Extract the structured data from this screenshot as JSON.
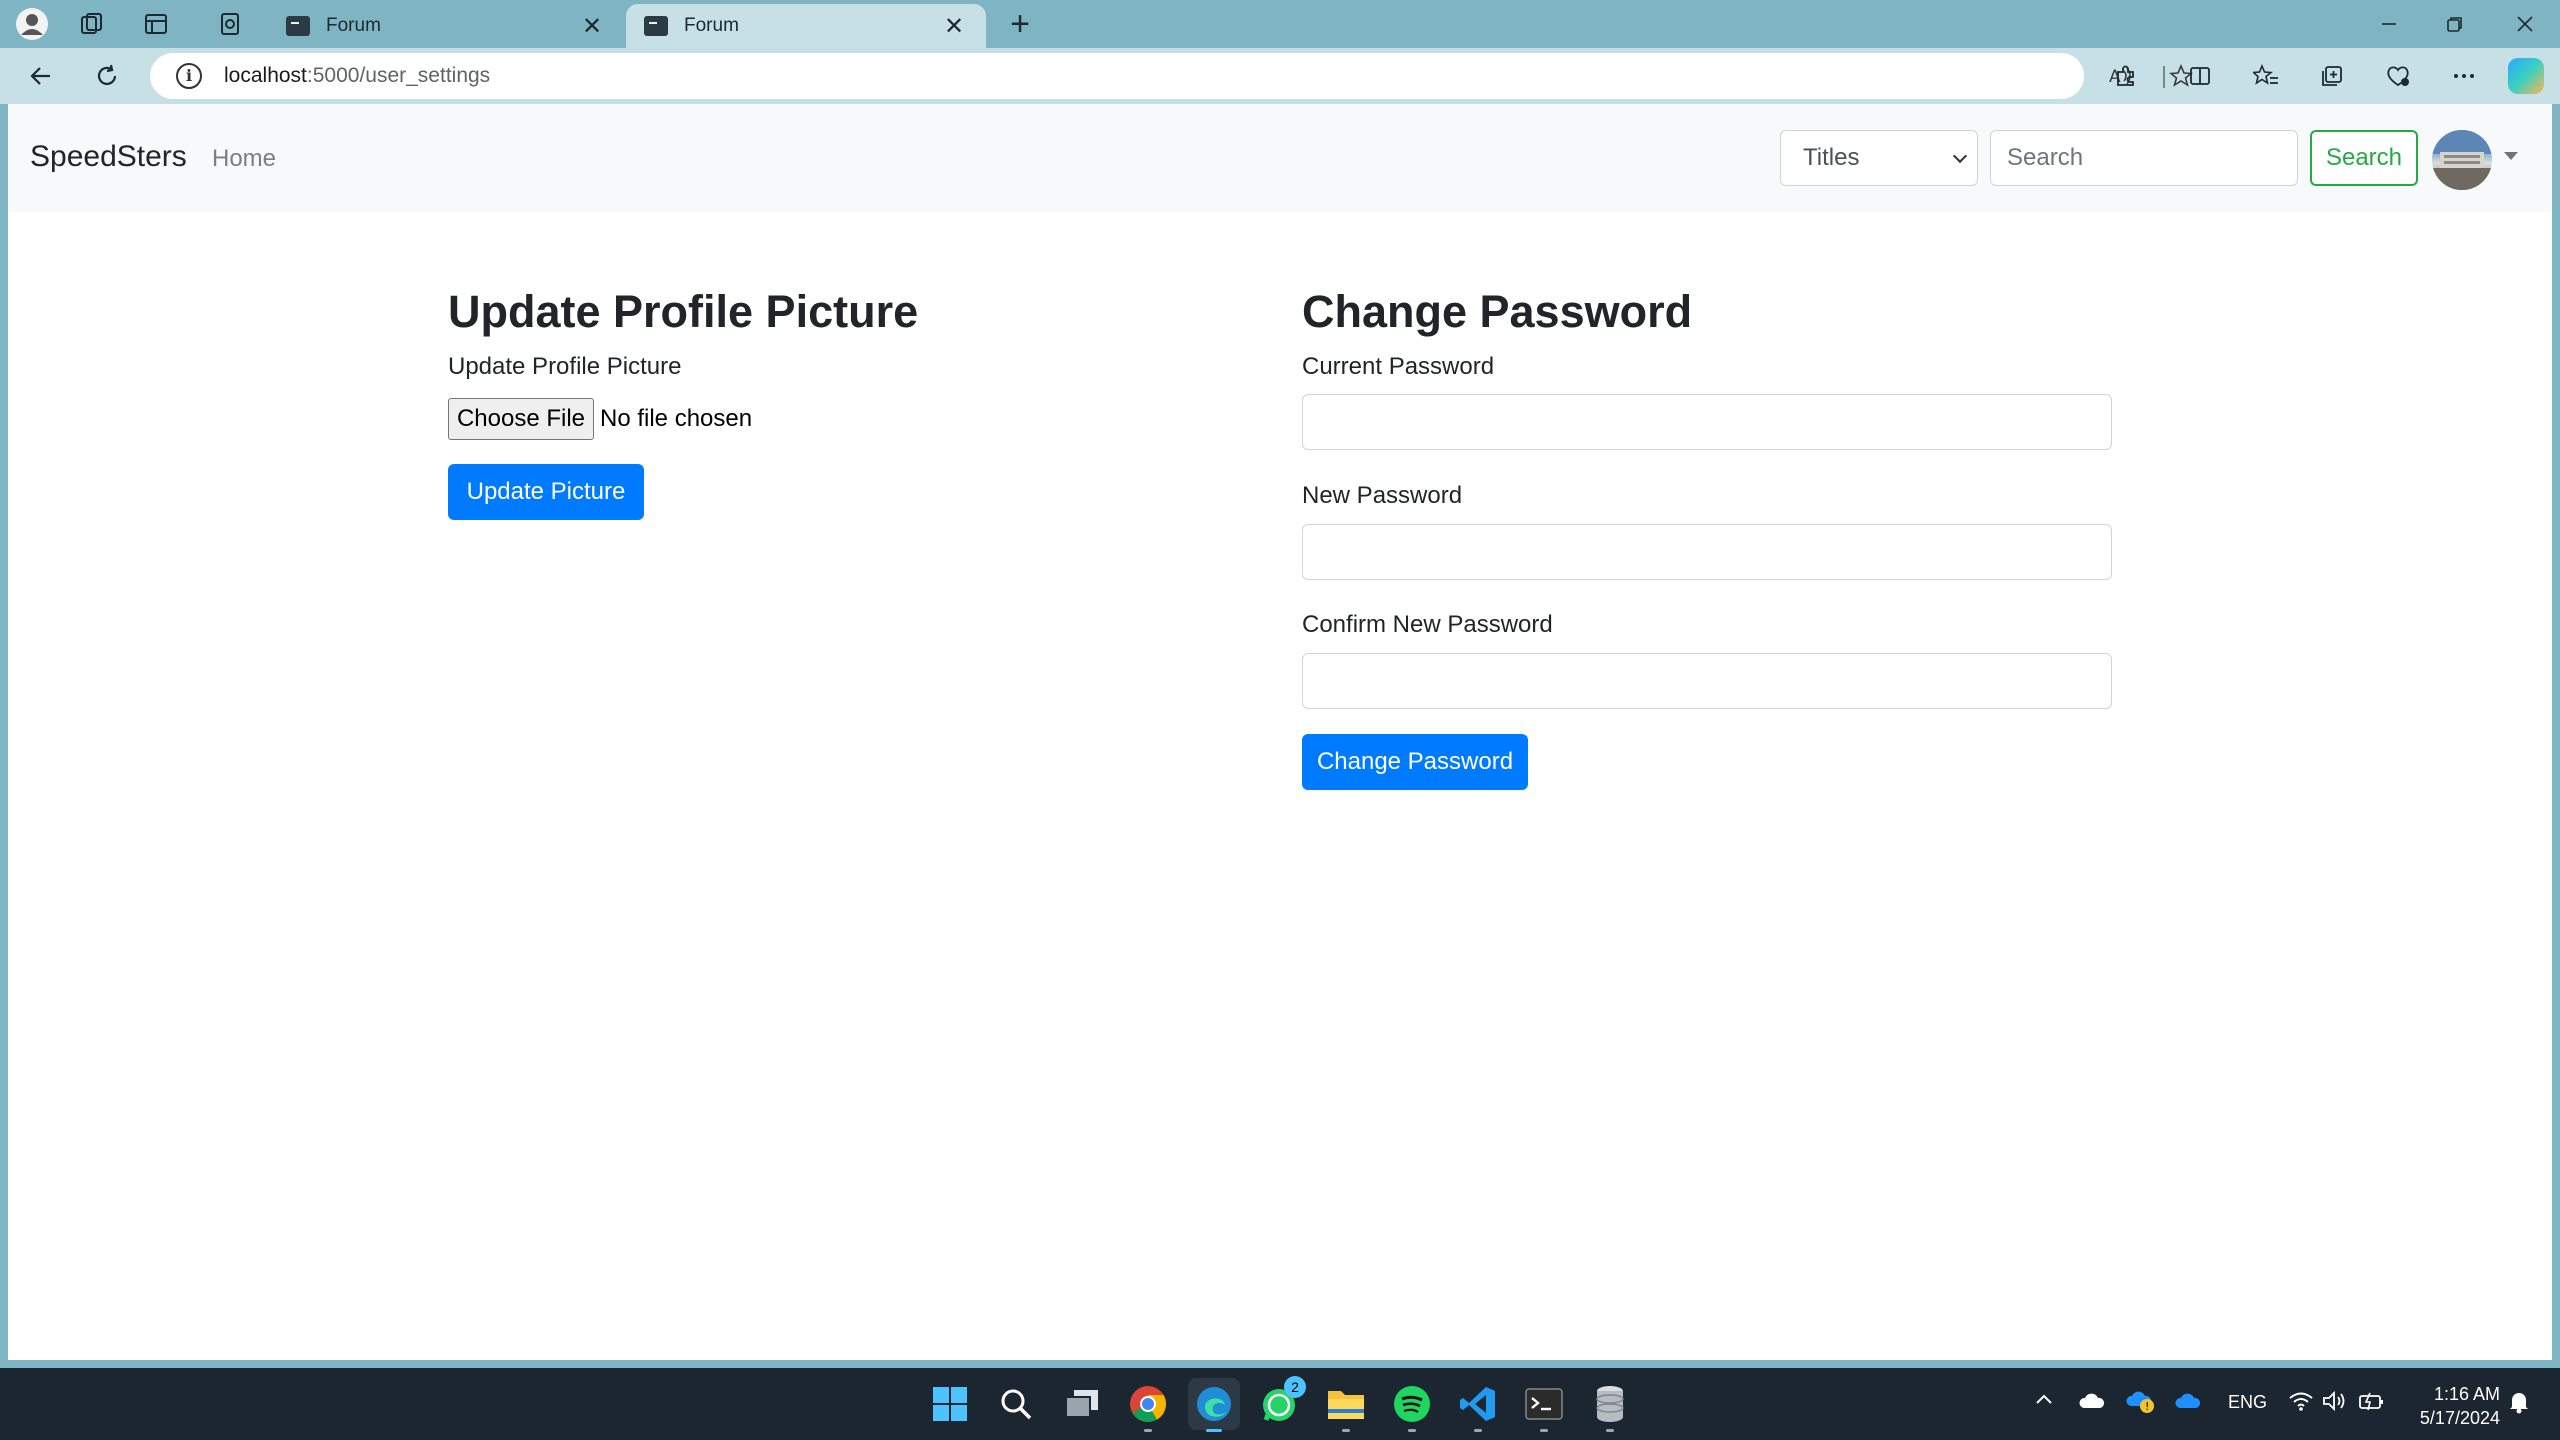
{
  "browser": {
    "tabs": [
      {
        "title": "Forum",
        "active": false
      },
      {
        "title": "Forum",
        "active": true
      }
    ],
    "url_host": "localhost",
    "url_path": ":5000/user_settings"
  },
  "navbar": {
    "brand": "SpeedSters",
    "home_label": "Home",
    "search_type_selected": "Titles",
    "search_placeholder": "Search",
    "search_button_label": "Search"
  },
  "profile_picture": {
    "heading": "Update Profile Picture",
    "label": "Update Profile Picture",
    "choose_file_label": "Choose File",
    "no_file_text": "No file chosen",
    "submit_label": "Update Picture"
  },
  "change_password": {
    "heading": "Change Password",
    "current_label": "Current Password",
    "new_label": "New Password",
    "confirm_label": "Confirm New Password",
    "submit_label": "Change Password"
  },
  "taskbar": {
    "apps": [
      "windows-start",
      "search",
      "task-view",
      "chrome",
      "edge",
      "whatsapp",
      "file-explorer",
      "spotify",
      "vscode",
      "terminal",
      "database"
    ],
    "whatsapp_badge": "2",
    "language": "ENG",
    "time": "1:16 AM",
    "date": "5/17/2024"
  },
  "colors": {
    "primary": "#007bff",
    "success": "#28a745",
    "navbar_bg": "#f8f9fa",
    "browser_frame": "#7fb5c2",
    "taskbar_bg": "#1c2630"
  }
}
